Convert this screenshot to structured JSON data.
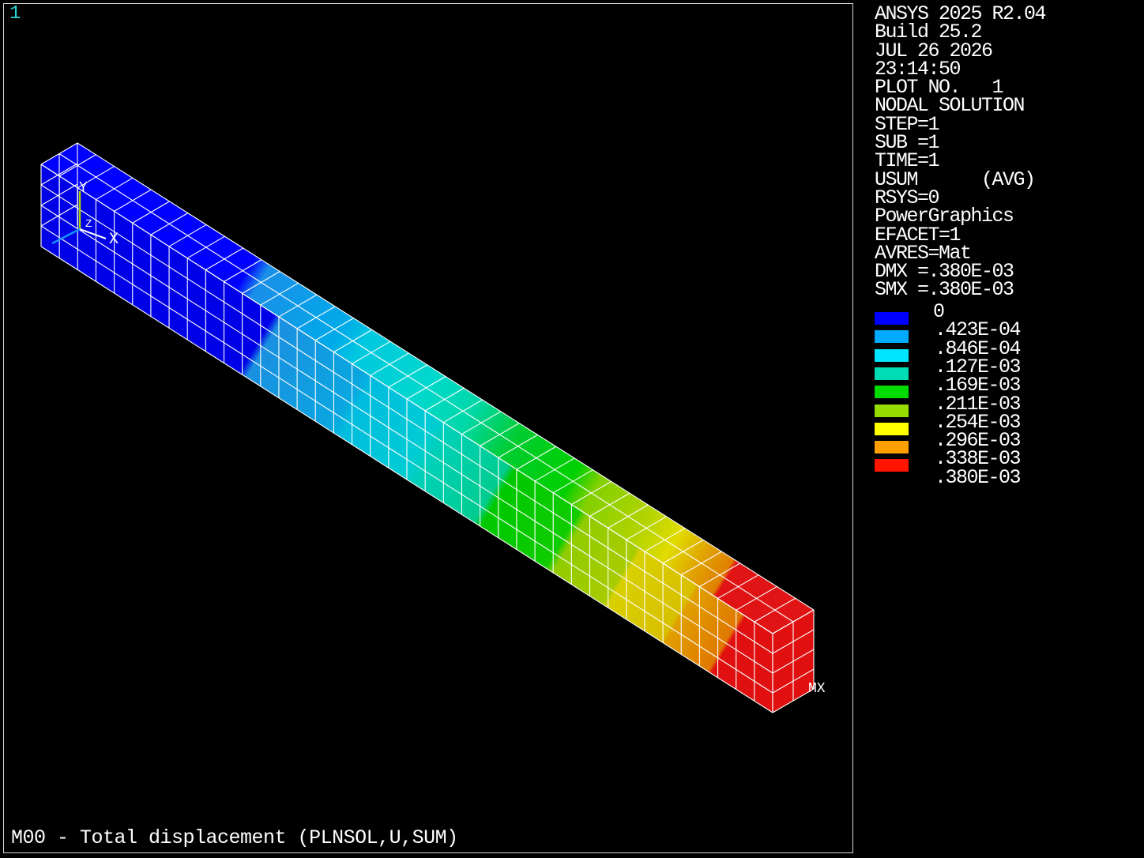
{
  "window_number": "1",
  "caption": "M00 - Total displacement (PLNSOL,U,SUM)",
  "info_lines": [
    "ANSYS 2025 R2.04",
    "Build 25.2",
    "JUL 26 2026",
    "23:14:50",
    "PLOT NO.   1",
    "NODAL SOLUTION",
    "STEP=1",
    "SUB =1",
    "TIME=1",
    "USUM      (AVG)",
    "RSYS=0",
    "PowerGraphics",
    "EFACET=1",
    "AVRES=Mat",
    "DMX =.380E-03",
    "SMX =.380E-03"
  ],
  "legend": {
    "labels": [
      "0",
      ".423E-04",
      ".846E-04",
      ".127E-03",
      ".169E-03",
      ".211E-03",
      ".254E-03",
      ".296E-03",
      ".338E-03",
      ".380E-03"
    ],
    "colors": [
      "#0000ff",
      "#00aaff",
      "#00e5ff",
      "#00dcb4",
      "#00dc00",
      "#96dc00",
      "#ffff00",
      "#ffa000",
      "#ff1400"
    ]
  },
  "triad": {
    "y_label": "Y",
    "x_label": "X",
    "z_label": "Z"
  },
  "max_marker": "MX",
  "colors": {
    "background": "#000000",
    "border": "#d8d8d8",
    "window_number": "#2bd1d1",
    "mesh": "#ffffff"
  }
}
